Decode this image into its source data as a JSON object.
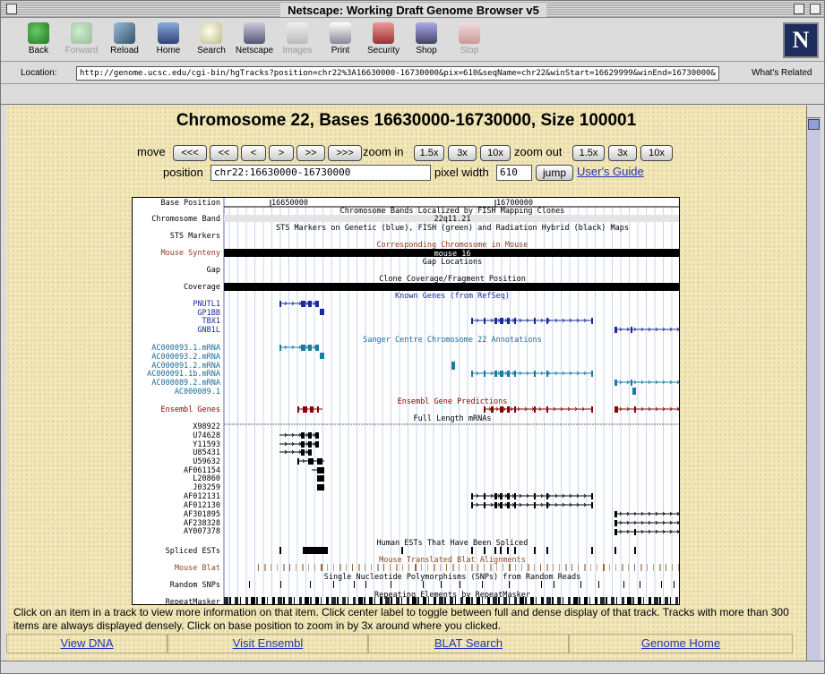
{
  "window": {
    "title": "Netscape: Working Draft Genome Browser v5"
  },
  "toolbar": {
    "back": "Back",
    "forward": "Forward",
    "reload": "Reload",
    "home": "Home",
    "search": "Search",
    "netscape": "Netscape",
    "images": "Images",
    "print": "Print",
    "security": "Security",
    "shop": "Shop",
    "stop": "Stop"
  },
  "location": {
    "label": "Location:",
    "url": "http://genome.ucsc.edu/cgi-bin/hgTracks?position=chr22%3A16630000-16730000&pix=610&seqName=chr22&winStart=16629999&winEnd=16730000&",
    "related": "What's Related"
  },
  "page": {
    "title": "Chromosome 22, Bases 16630000-16730000, Size 100001"
  },
  "controls": {
    "move_label": "move",
    "move_buttons": [
      "<<<",
      "<<",
      "<",
      ">",
      ">>",
      ">>>"
    ],
    "zoom_in_label": "zoom in",
    "zoom_in_buttons": [
      "1.5x",
      "3x",
      "10x"
    ],
    "zoom_out_label": "zoom out",
    "zoom_out_buttons": [
      "1.5x",
      "3x",
      "10x"
    ],
    "position_label": "position",
    "position_value": "chr22:16630000-16730000",
    "pixel_width_label": "pixel width",
    "pixel_width_value": "610",
    "jump_button": "jump",
    "users_guide": "User's Guide"
  },
  "tracks": {
    "ruler": {
      "label": "Base Position",
      "ticks": [
        "16650000",
        "16700000"
      ]
    },
    "labels": [
      {
        "text": "Chromosome Band",
        "color": "#000000"
      },
      {
        "text": "STS Markers",
        "color": "#000000"
      },
      {
        "text": "Mouse Synteny",
        "color": "#8b3a1a"
      },
      {
        "text": "Gap",
        "color": "#000000"
      },
      {
        "text": "Coverage",
        "color": "#000000"
      },
      {
        "text": "PNUTL1",
        "color": "#1a2a99"
      },
      {
        "text": "GP1BB",
        "color": "#1a2a99"
      },
      {
        "text": "TBX1",
        "color": "#1a2a99"
      },
      {
        "text": "GNB1L",
        "color": "#1a2a99"
      },
      {
        "text": "AC000093.1.mRNA",
        "color": "#1a6a99"
      },
      {
        "text": "AC000093.2.mRNA",
        "color": "#1a6a99"
      },
      {
        "text": "AC000091.2.mRNA",
        "color": "#1a6a99"
      },
      {
        "text": "AC000091.1b.mRNA",
        "color": "#1a6a99"
      },
      {
        "text": "AC000089.2.mRNA",
        "color": "#1a6a99"
      },
      {
        "text": "AC000089.1",
        "color": "#1a6a99"
      },
      {
        "text": "Ensembl Genes",
        "color": "#8b0000"
      },
      {
        "text": "X98922",
        "color": "#000000"
      },
      {
        "text": "U74628",
        "color": "#000000"
      },
      {
        "text": "Y11593",
        "color": "#000000"
      },
      {
        "text": "U85431",
        "color": "#000000"
      },
      {
        "text": "U59632",
        "color": "#000000"
      },
      {
        "text": "AF061154",
        "color": "#000000"
      },
      {
        "text": "L20860",
        "color": "#000000"
      },
      {
        "text": "J03259",
        "color": "#000000"
      },
      {
        "text": "AF012131",
        "color": "#000000"
      },
      {
        "text": "AF012130",
        "color": "#000000"
      },
      {
        "text": "AF301895",
        "color": "#000000"
      },
      {
        "text": "AF238328",
        "color": "#000000"
      },
      {
        "text": "AY007378",
        "color": "#000000"
      },
      {
        "text": "Spliced ESTs",
        "color": "#000000"
      },
      {
        "text": "Mouse Blat",
        "color": "#8b4a1a"
      },
      {
        "text": "Random SNPs",
        "color": "#000000"
      },
      {
        "text": "RepeatMasker",
        "color": "#000000"
      }
    ],
    "headers": [
      {
        "text": "Chromosome Bands Localized by FISH Mapping Clones",
        "color": "#000000"
      },
      {
        "text": "STS Markers on Genetic (blue), FISH (green) and Radiation Hybrid (black) Maps",
        "color": "#000000"
      },
      {
        "text": "Corresponding Chromosome in Mouse",
        "color": "#8b3a1a"
      },
      {
        "text": "Gap Locations",
        "color": "#000000"
      },
      {
        "text": "Clone Coverage/Fragment Position",
        "color": "#000000"
      },
      {
        "text": "Known Genes (from RefSeq)",
        "color": "#1a2a99"
      },
      {
        "text": "Sanger Centre Chromosome 22 Annotations",
        "color": "#1a6a99"
      },
      {
        "text": "Ensembl Gene Predictions",
        "color": "#8b0000"
      },
      {
        "text": "Full Length mRNAs",
        "color": "#000000"
      },
      {
        "text": "Human ESTs That Have Been Spliced",
        "color": "#000000"
      },
      {
        "text": "Mouse Translated Blat Alignments",
        "color": "#8b4a1a"
      },
      {
        "text": "Single Nucleotide Polymorphisms (SNPs) from Random Reads",
        "color": "#000000"
      },
      {
        "text": "Repeating Elements by RepeatMasker",
        "color": "#000000"
      }
    ],
    "band_label": "22q11.21",
    "mouse_synteny_label": "mouse 16"
  },
  "help_text": "Click on an item in a track to view more information on that item. Click center label to toggle between full and dense display of that track. Tracks with more than 300 items are always displayed densely. Click on base position to zoom in by 3x around where you clicked.",
  "footer_links": [
    "View DNA",
    "Visit Ensembl",
    "BLAT Search",
    "Genome Home"
  ]
}
